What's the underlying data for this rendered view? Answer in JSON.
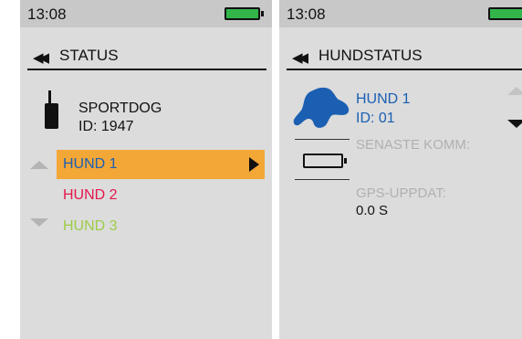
{
  "left_screen": {
    "status_bar": {
      "time": "13:08",
      "battery_icon": "battery-full-icon",
      "battery_color": "#33b54a"
    },
    "header": {
      "back_icon": "double-left-arrow-icon",
      "title": "STATUS"
    },
    "device": {
      "icon": "handheld-remote-icon",
      "name": "SPORTDOG",
      "id": "ID: 1947"
    },
    "dogs": [
      {
        "label": "HUND 1",
        "color": "#1b5fb3",
        "selected": true
      },
      {
        "label": "HUND 2",
        "color": "#e4174b",
        "selected": false
      },
      {
        "label": "HUND 3",
        "color": "#9ccc45",
        "selected": false
      }
    ],
    "selection_color": "#f3a737"
  },
  "right_screen": {
    "status_bar": {
      "time": "13:08",
      "battery_icon": "battery-full-icon"
    },
    "header": {
      "back_icon": "double-left-arrow-icon",
      "title": "HUNDSTATUS"
    },
    "dog": {
      "icon": "dog-head-icon",
      "name": "HUND 1",
      "id": "ID: 01",
      "color": "#1b5fb3"
    },
    "collar_battery_icon": "battery-empty-icon",
    "last_comm_label": "SENASTE KOMM:",
    "gps_update_label": "GPS-UPPDAT:",
    "gps_update_value": "0.0 S"
  }
}
